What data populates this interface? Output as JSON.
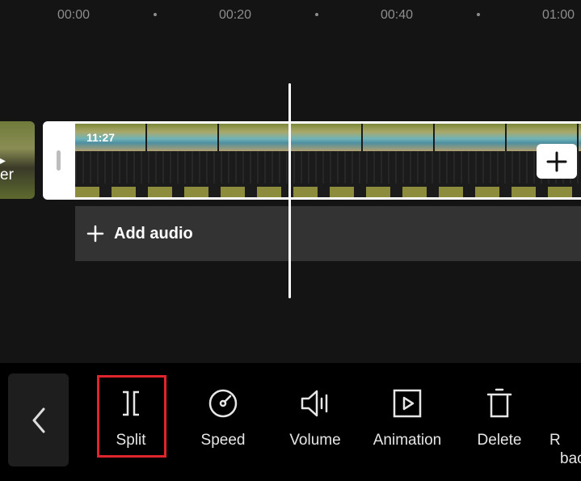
{
  "timeline": {
    "ruler": [
      "00:00",
      "00:20",
      "00:40",
      "01:00"
    ],
    "clip_duration": "11:27",
    "prev_clip_text": "er",
    "add_audio_label": "Add audio"
  },
  "toolbar": {
    "tools": [
      {
        "label": "Split"
      },
      {
        "label": "Speed"
      },
      {
        "label": "Volume"
      },
      {
        "label": "Animation"
      },
      {
        "label": "Delete"
      },
      {
        "label": "R",
        "label2": "bac"
      }
    ]
  },
  "colors": {
    "background": "#141414",
    "audio_track": "#333333",
    "highlight": "#e0242e",
    "toolbar_bg": "#000000"
  }
}
